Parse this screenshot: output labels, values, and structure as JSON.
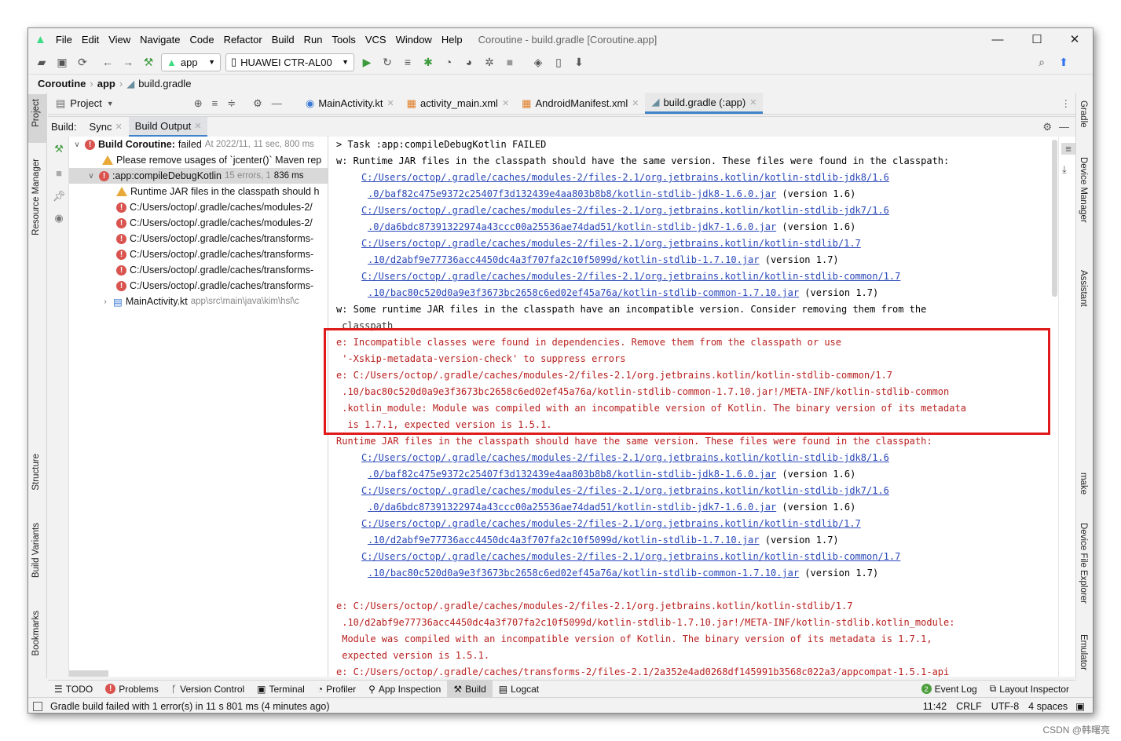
{
  "menu": [
    "File",
    "Edit",
    "View",
    "Navigate",
    "Code",
    "Refactor",
    "Build",
    "Run",
    "Tools",
    "VCS",
    "Window",
    "Help"
  ],
  "window_title": "Coroutine - build.gradle [Coroutine.app]",
  "toolbar": {
    "run_config": "app",
    "device": "HUAWEI CTR-AL00"
  },
  "breadcrumb": {
    "project": "Coroutine",
    "module": "app",
    "file": "build.gradle"
  },
  "left_strip": {
    "project": "Project",
    "resource_manager": "Resource Manager",
    "structure": "Structure",
    "build_variants": "Build Variants",
    "bookmarks": "Bookmarks"
  },
  "right_strip": {
    "gradle": "Gradle",
    "device_manager": "Device Manager",
    "assistant": "Assistant",
    "make": "make",
    "device_file_explorer": "Device File Explorer",
    "emulator": "Emulator"
  },
  "project_panel": {
    "label": "Project"
  },
  "editor_tabs": [
    "MainActivity.kt",
    "activity_main.xml",
    "AndroidManifest.xml",
    "build.gradle (:app)"
  ],
  "build_bar": {
    "label": "Build:",
    "tabs": [
      "Sync",
      "Build Output"
    ]
  },
  "tree": {
    "root_title": "Build Coroutine:",
    "root_status": "failed",
    "root_meta": "At 2022/11,",
    "root_time": "11 sec, 800 ms",
    "warning_1": "Please remove usages of `jcenter()` Maven rep",
    "task": ":app:compileDebugKotlin",
    "task_meta": "15 errors, 1",
    "task_time": "836 ms",
    "warning_2": "Runtime JAR files in the classpath should h",
    "errors": [
      "C:/Users/octop/.gradle/caches/modules-2/",
      "C:/Users/octop/.gradle/caches/modules-2/",
      "C:/Users/octop/.gradle/caches/transforms-",
      "C:/Users/octop/.gradle/caches/transforms-",
      "C:/Users/octop/.gradle/caches/transforms-",
      "C:/Users/octop/.gradle/caches/transforms-"
    ],
    "main_activity": "MainActivity.kt",
    "main_activity_path": "app\\src\\main\\java\\kim\\hsl\\c"
  },
  "console": {
    "l01": "> Task :app:compileDebugKotlin FAILED",
    "l02": "w: Runtime JAR files in the classpath should have the same version. These files were found in the classpath:",
    "l03": "C:/Users/octop/.gradle/caches/modules-2/files-2.1/org.jetbrains.kotlin/kotlin-stdlib-jdk8/1.6",
    "l04": ".0/baf82c475e9372c25407f3d132439e4aa803b8b8/kotlin-stdlib-jdk8-1.6.0.jar",
    "l05": "C:/Users/octop/.gradle/caches/modules-2/files-2.1/org.jetbrains.kotlin/kotlin-stdlib-jdk7/1.6",
    "l06": ".0/da6bdc87391322974a43ccc00a25536ae74dad51/kotlin-stdlib-jdk7-1.6.0.jar",
    "l07": "C:/Users/octop/.gradle/caches/modules-2/files-2.1/org.jetbrains.kotlin/kotlin-stdlib/1.7",
    "l08": ".10/d2abf9e77736acc4450dc4a3f707fa2c10f5099d/kotlin-stdlib-1.7.10.jar",
    "l09": "C:/Users/octop/.gradle/caches/modules-2/files-2.1/org.jetbrains.kotlin/kotlin-stdlib-common/1.7",
    "l10": ".10/bac80c520d0a9e3f3673bc2658c6ed02ef45a76a/kotlin-stdlib-common-1.7.10.jar",
    "v16": " (version 1.6)",
    "v17": " (version 1.7)",
    "l11": "w: Some runtime JAR files in the classpath have an incompatible version. Consider removing them from the",
    "l12": " classpath",
    "l13": "e: Incompatible classes were found in dependencies. Remove them from the classpath or use",
    "l14": " '-Xskip-metadata-version-check' to suppress errors",
    "l15": "e: C:/Users/octop/.gradle/caches/modules-2/files-2.1/org.jetbrains.kotlin/kotlin-stdlib-common/1.7",
    "l16": " .10/bac80c520d0a9e3f3673bc2658c6ed02ef45a76a/kotlin-stdlib-common-1.7.10.jar!/META-INF/kotlin-stdlib-common",
    "l17": " .kotlin_module: Module was compiled with an incompatible version of Kotlin. The binary version of its metadata",
    "l18": "  is 1.7.1, expected version is 1.5.1.",
    "l19": "Runtime JAR files in the classpath should have the same version. These files were found in the classpath:",
    "l20": "e: C:/Users/octop/.gradle/caches/modules-2/files-2.1/org.jetbrains.kotlin/kotlin-stdlib/1.7",
    "l21": " .10/d2abf9e77736acc4450dc4a3f707fa2c10f5099d/kotlin-stdlib-1.7.10.jar!/META-INF/kotlin-stdlib.kotlin_module:",
    "l22": " Module was compiled with an incompatible version of Kotlin. The binary version of its metadata is 1.7.1,",
    "l23": " expected version is 1.5.1.",
    "l24": "e: C:/Users/octop/.gradle/caches/transforms-2/files-2.1/2a352e4ad0268df145991b3568c022a3/appcompat-1.5.1-api"
  },
  "bottom_tabs": [
    "TODO",
    "Problems",
    "Version Control",
    "Terminal",
    "Profiler",
    "App Inspection",
    "Build",
    "Logcat"
  ],
  "bottom_right": {
    "event_log": "Event Log",
    "layout_inspector": "Layout Inspector",
    "event_count": "2"
  },
  "status": {
    "message": "Gradle build failed with 1 error(s) in 11 s 801 ms (4 minutes ago)",
    "position": "11:42",
    "line_sep": "CRLF",
    "encoding": "UTF-8",
    "indent": "4 spaces"
  },
  "watermark": "CSDN @韩曙亮",
  "colors": {
    "error": "#b8201f",
    "link": "#2a48b8",
    "highlight": "#e01a1a",
    "accent": "#4083c9"
  }
}
